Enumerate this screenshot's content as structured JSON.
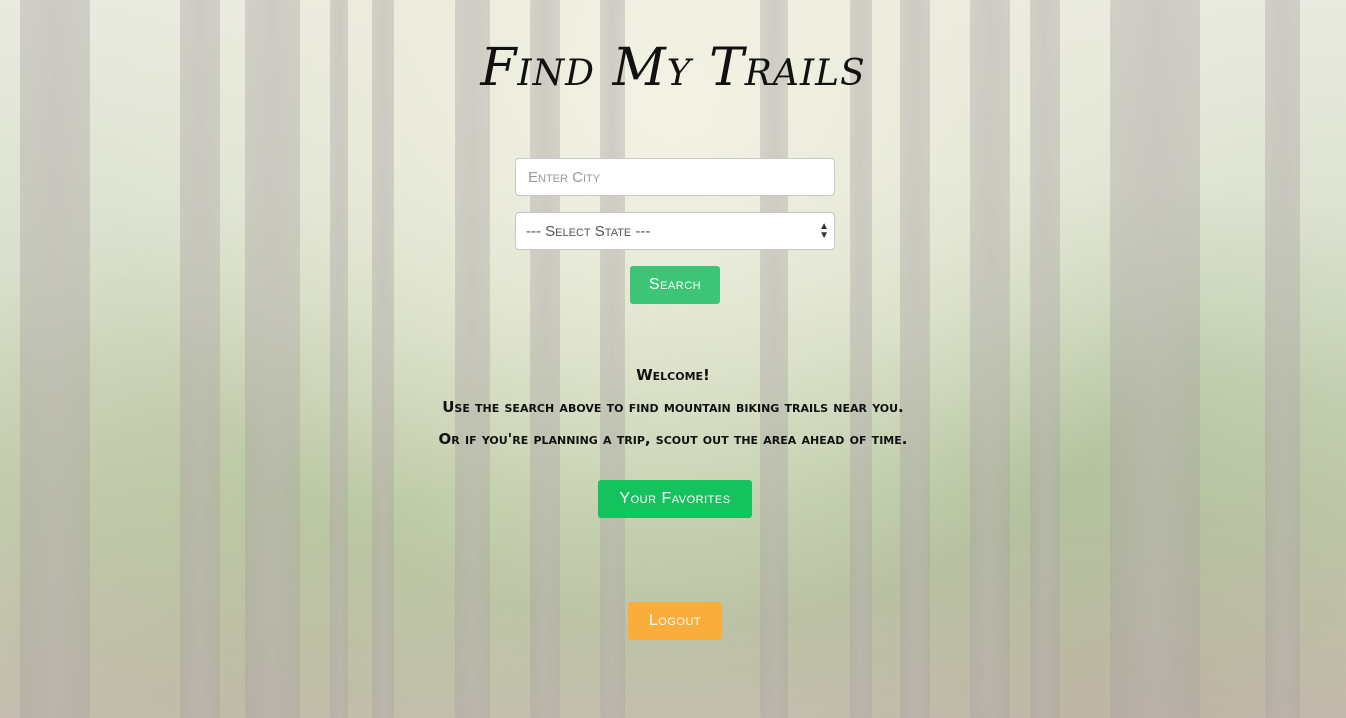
{
  "app": {
    "title": "Find My Trails"
  },
  "search": {
    "city_placeholder": "Enter City",
    "state_selected": "--- Select State ---",
    "button_label": "Search"
  },
  "welcome": {
    "heading": "Welcome!",
    "line1": "Use the search above to find mountain biking trails near you.",
    "line2": "Or if you're planning a trip, scout out the area ahead of time."
  },
  "actions": {
    "favorites_label": "Your Favorites",
    "logout_label": "Logout"
  },
  "colors": {
    "search_button": "#3cc477",
    "favorites_button": "#14c35e",
    "logout_button": "#f9ad3a"
  },
  "icons": {
    "select_arrows": "up-down-arrows-icon"
  }
}
